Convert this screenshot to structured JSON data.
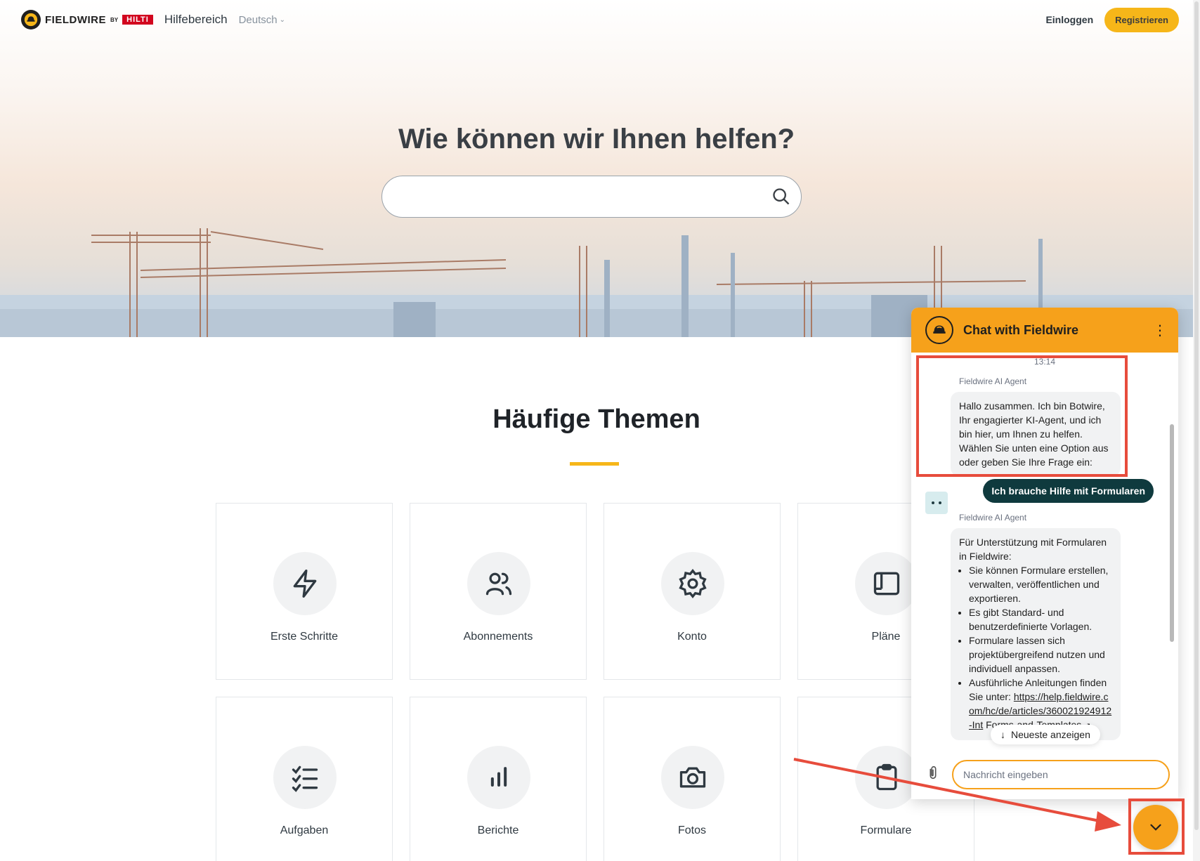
{
  "header": {
    "brand": "FIELDWIRE",
    "brand_by": "BY",
    "hilti": "HILTI",
    "help_center": "Hilfebereich",
    "language": "Deutsch",
    "login": "Einloggen",
    "register": "Registrieren"
  },
  "hero": {
    "title": "Wie können wir Ihnen helfen?",
    "search_placeholder": ""
  },
  "topics": {
    "title": "Häufige Themen",
    "cards": [
      {
        "label": "Erste Schritte",
        "icon": "lightning-icon"
      },
      {
        "label": "Abonnements",
        "icon": "users-icon"
      },
      {
        "label": "Konto",
        "icon": "gear-icon"
      },
      {
        "label": "Pläne",
        "icon": "plans-icon"
      },
      {
        "label": "Aufgaben",
        "icon": "checklist-icon"
      },
      {
        "label": "Berichte",
        "icon": "bar-chart-icon"
      },
      {
        "label": "Fotos",
        "icon": "camera-icon"
      },
      {
        "label": "Formulare",
        "icon": "clipboard-icon"
      }
    ]
  },
  "chat": {
    "title": "Chat with Fieldwire",
    "timestamp": "13:14",
    "sender": "Fieldwire AI Agent",
    "greeting": "Hallo zusammen. Ich bin Botwire, Ihr engagierter KI-Agent, und ich bin hier, um Ihnen zu helfen. Wählen Sie unten eine Option aus oder geben Sie Ihre Frage ein:",
    "user_message": "Ich brauche Hilfe mit Formularen",
    "reply_intro": "Für Unterstützung mit Formularen in Fieldwire:",
    "reply_items": [
      "Sie können Formulare erstellen, verwalten, veröffentlichen und exportieren.",
      "Es gibt Standard- und benutzerdefinierte Vorlagen.",
      "Formulare lassen sich projektübergreifend nutzen und individuell anpassen.",
      "Ausführliche Anleitungen finden Sie unter:"
    ],
    "reply_link": "https://help.fieldwire.com/hc/de/articles/360021924912-Int",
    "reply_link_tail": "Forms-and-Templates",
    "newest_label": "Neueste anzeigen",
    "input_placeholder": "Nachricht eingeben"
  },
  "colors": {
    "accent": "#f6a11b",
    "brand_yellow": "#f6b619",
    "user_bubble": "#0f3a3e",
    "annotation": "#e74c3c"
  }
}
